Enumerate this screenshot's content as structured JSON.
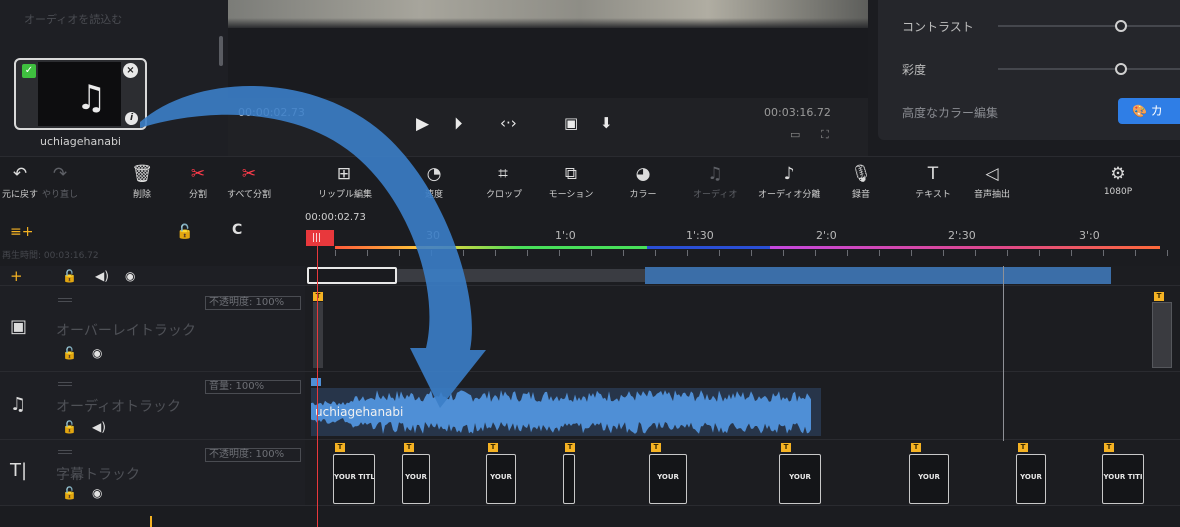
{
  "media": {
    "load_audio": "オーディオを読込む",
    "file_name": "uchiagehanabi",
    "check": "✓",
    "close": "×",
    "info": "i"
  },
  "preview": {
    "current_time": "00:00:02.73",
    "total_time": "00:03:16.72"
  },
  "color_panel": {
    "contrast_label": "コントラスト",
    "saturation_label": "彩度",
    "advanced_label": "高度なカラー編集",
    "advanced_button": "カ",
    "contrast_value": 0.5,
    "saturation_value": 0.5
  },
  "toolbar": {
    "undo": "元に戻す",
    "redo": "やり直し",
    "delete": "削除",
    "split": "分割",
    "split_all": "すべて分割",
    "ripple_edit": "リップル編集",
    "speed": "速度",
    "crop": "クロップ",
    "motion": "モーション",
    "color": "カラー",
    "audio": "オーディオ",
    "audio_split": "オーディオ分離",
    "record": "録音",
    "text": "テキスト",
    "voice_extract": "音声抽出",
    "resolution": "1080P"
  },
  "timeline": {
    "playhead_time": "00:00:02.73",
    "duration": "再生時間: 00:03:16.72",
    "ticks": [
      "30",
      "1':0",
      "1':30",
      "2':0",
      "2':30",
      "3':0"
    ],
    "playhead_marker": "|||"
  },
  "tracks": {
    "overlay": {
      "name": "オーバーレイトラック",
      "opacity": "不透明度: 100%"
    },
    "audio": {
      "name": "オーディオトラック",
      "volume": "音量: 100%",
      "clip_name": "uchiagehanabi"
    },
    "subtitle": {
      "name": "字幕トラック",
      "opacity": "不透明度: 100%"
    }
  },
  "title_clips": [
    "YOUR TITLE",
    "YOUR",
    "YOUR",
    "",
    "YOUR",
    "YOUR",
    "YOUR",
    "YOUR",
    "YOUR TITI"
  ],
  "badge_letter": "T",
  "colors": {
    "accent": "#2f7ee6",
    "playhead": "#e8383c",
    "badge": "#f4b223",
    "waveform": "#4f8fd6"
  }
}
